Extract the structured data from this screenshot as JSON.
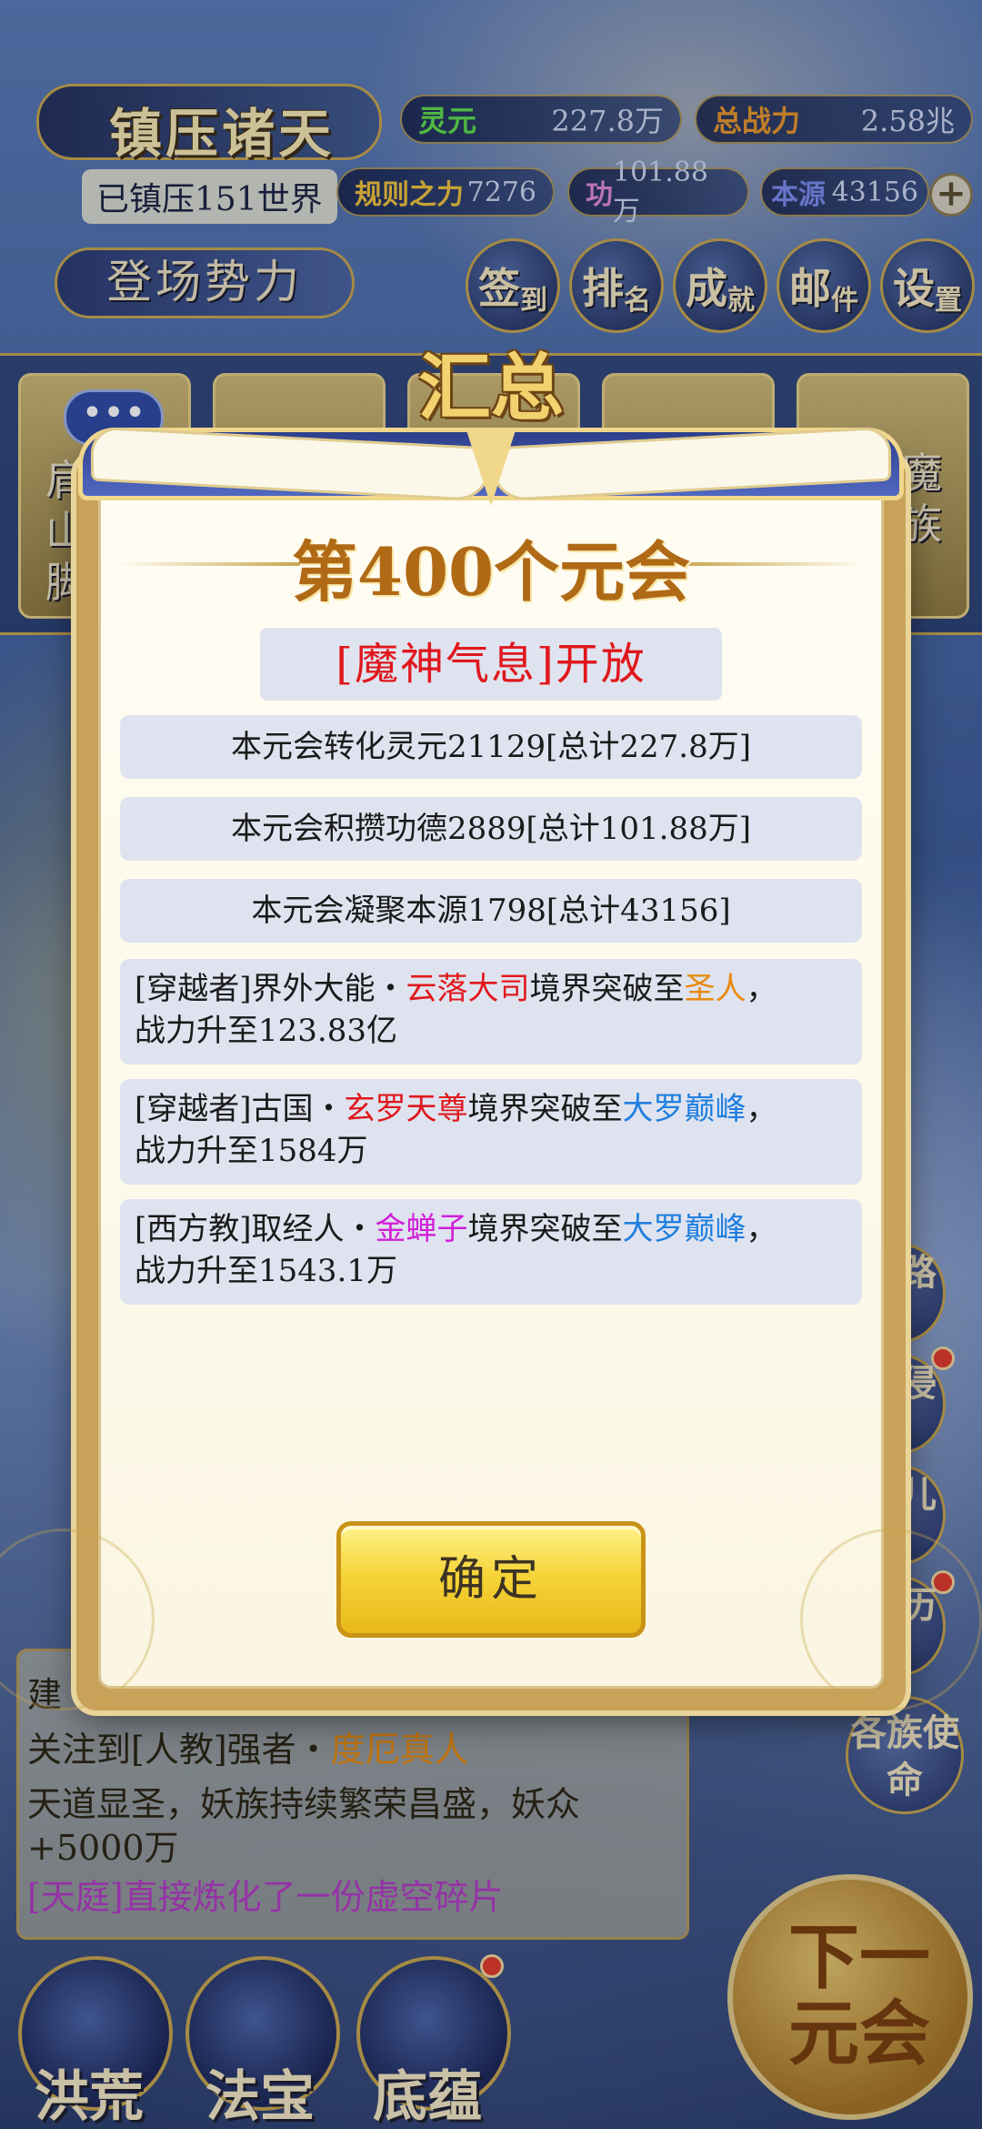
{
  "hud": {
    "game_title": "镇压诸天",
    "world_count": "已镇压151世界",
    "lingyuan_label": "灵元",
    "lingyuan_value": "227.8万",
    "power_label": "总战力",
    "power_value": "2.58兆",
    "rule_label": "规则之力",
    "rule_value": "7276",
    "merit_label": "功",
    "merit_value": "101.88万",
    "source_label": "本源",
    "source_value": "43156",
    "plus": "+",
    "faction_button": "登场势力",
    "menu": [
      {
        "main": "签",
        "sub": "到"
      },
      {
        "main": "排",
        "sub": "名"
      },
      {
        "main": "成",
        "sub": "就"
      },
      {
        "main": "邮",
        "sub": "件"
      },
      {
        "main": "设",
        "sub": "置"
      }
    ]
  },
  "regions": {
    "chat_icon": "•••",
    "left_text": "肩山脚",
    "right_text": "魔族"
  },
  "side_buttons": [
    "道路",
    "域侵",
    "道儿",
    "阅历",
    "各族使命"
  ],
  "log": {
    "line1_prefix": "建",
    "line2_a": "关注到[人教]强者・",
    "line2_b": "度厄真人",
    "line3": "天道显圣，妖族持续繁荣昌盛，妖众",
    "line4": "+5000万",
    "line5": "[天庭]直接炼化了一份虚空碎片"
  },
  "bottom_nav": {
    "items": [
      "洪荒",
      "法宝",
      "底蕴"
    ],
    "next_button": "下一元会"
  },
  "dialog": {
    "header": "汇总",
    "title": "第400个元会",
    "event": "[魔神气息]开放",
    "summary": [
      "本元会转化灵元21129[总计227.8万]",
      "本元会积攒功德2889[总计101.88万]",
      "本元会凝聚本源1798[总计43156]"
    ],
    "news": [
      {
        "prefix": "[穿越者]界外大能・",
        "name": "云落大司",
        "mid": "境界突破至",
        "realm": "圣人",
        "suffix": "，",
        "line2": "战力升至123.83亿"
      },
      {
        "prefix": "[穿越者]古国・",
        "name": "玄罗天尊",
        "mid": "境界突破至",
        "realm": "大罗巅峰",
        "suffix": "，",
        "line2": "战力升至1584万"
      },
      {
        "prefix": "[西方教]取经人・",
        "name": "金蝉子",
        "mid": "境界突破至",
        "realm": "大罗巅峰",
        "suffix": "，",
        "line2": "战力升至1543.1万"
      }
    ],
    "confirm": "确定"
  },
  "colors": {
    "event_red": "#e0181d",
    "realm_orange": "#e88a0c",
    "realm_blue": "#1f7fe0",
    "name_purple": "#d21ed8",
    "gold": "#c9a64e"
  }
}
